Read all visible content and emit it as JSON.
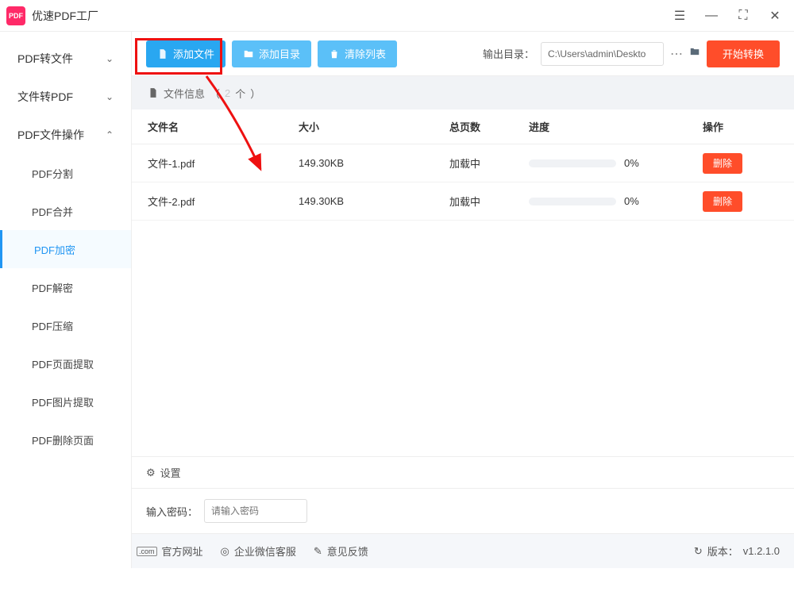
{
  "app": {
    "name": "优速PDF工厂"
  },
  "sidebar": {
    "items": [
      {
        "label": "PDF转文件",
        "expanded": false
      },
      {
        "label": "文件转PDF",
        "expanded": false
      },
      {
        "label": "PDF文件操作",
        "expanded": true,
        "children": [
          {
            "label": "PDF分割"
          },
          {
            "label": "PDF合并"
          },
          {
            "label": "PDF加密",
            "active": true
          },
          {
            "label": "PDF解密"
          },
          {
            "label": "PDF压缩"
          },
          {
            "label": "PDF页面提取"
          },
          {
            "label": "PDF图片提取"
          },
          {
            "label": "PDF删除页面"
          }
        ]
      }
    ]
  },
  "toolbar": {
    "add_file": "添加文件",
    "add_dir": "添加目录",
    "clear": "清除列表",
    "out_label": "输出目录：",
    "out_path": "C:\\Users\\admin\\Deskto",
    "start": "开始转换"
  },
  "file_info": {
    "label": "文件信息",
    "count_suffix": "个"
  },
  "columns": {
    "name": "文件名",
    "size": "大小",
    "pages": "总页数",
    "progress": "进度",
    "op": "操作"
  },
  "rows": [
    {
      "name": "文件-1.pdf",
      "size": "149.30KB",
      "pages": "加载中",
      "progress": "0%",
      "op": "删除"
    },
    {
      "name": "文件-2.pdf",
      "size": "149.30KB",
      "pages": "加载中",
      "progress": "0%",
      "op": "删除"
    }
  ],
  "settings": {
    "title": "设置",
    "pw_label": "输入密码：",
    "pw_placeholder": "请输入密码"
  },
  "footer": {
    "official": "官方网址",
    "wechat": "企业微信客服",
    "feedback": "意见反馈",
    "version_label": "版本：",
    "version": "v1.2.1.0"
  }
}
